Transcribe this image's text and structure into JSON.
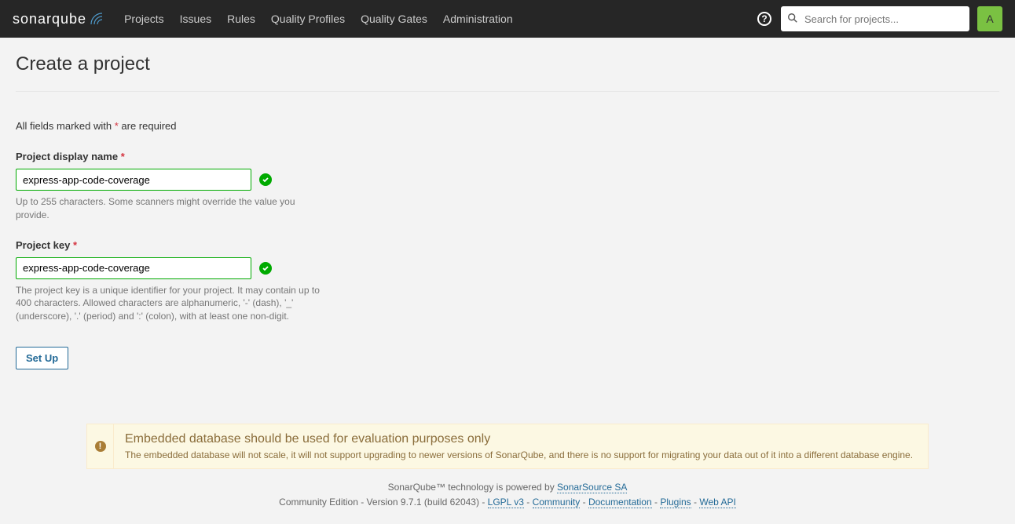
{
  "nav": {
    "logo": "sonarqube",
    "links": [
      "Projects",
      "Issues",
      "Rules",
      "Quality Profiles",
      "Quality Gates",
      "Administration"
    ],
    "search_placeholder": "Search for projects...",
    "avatar_initial": "A"
  },
  "page": {
    "title": "Create a project",
    "required_prefix": "All fields marked with ",
    "required_suffix": " are required"
  },
  "form": {
    "display_name": {
      "label": "Project display name",
      "value": "express-app-code-coverage",
      "help": "Up to 255 characters. Some scanners might override the value you provide."
    },
    "project_key": {
      "label": "Project key",
      "value": "express-app-code-coverage",
      "help": "The project key is a unique identifier for your project. It may contain up to 400 characters. Allowed characters are alphanumeric, '-' (dash), '_' (underscore), '.' (period) and ':' (colon), with at least one non-digit."
    },
    "submit_label": "Set Up"
  },
  "warning": {
    "title": "Embedded database should be used for evaluation purposes only",
    "text": "The embedded database will not scale, it will not support upgrading to newer versions of SonarQube, and there is no support for migrating your data out of it into a different database engine."
  },
  "footer": {
    "powered_prefix": "SonarQube™ technology is powered by ",
    "powered_link": "SonarSource SA",
    "edition": "Community Edition",
    "version": "Version 9.7.1 (build 62043)",
    "links": [
      "LGPL v3",
      "Community",
      "Documentation",
      "Plugins",
      "Web API"
    ]
  }
}
